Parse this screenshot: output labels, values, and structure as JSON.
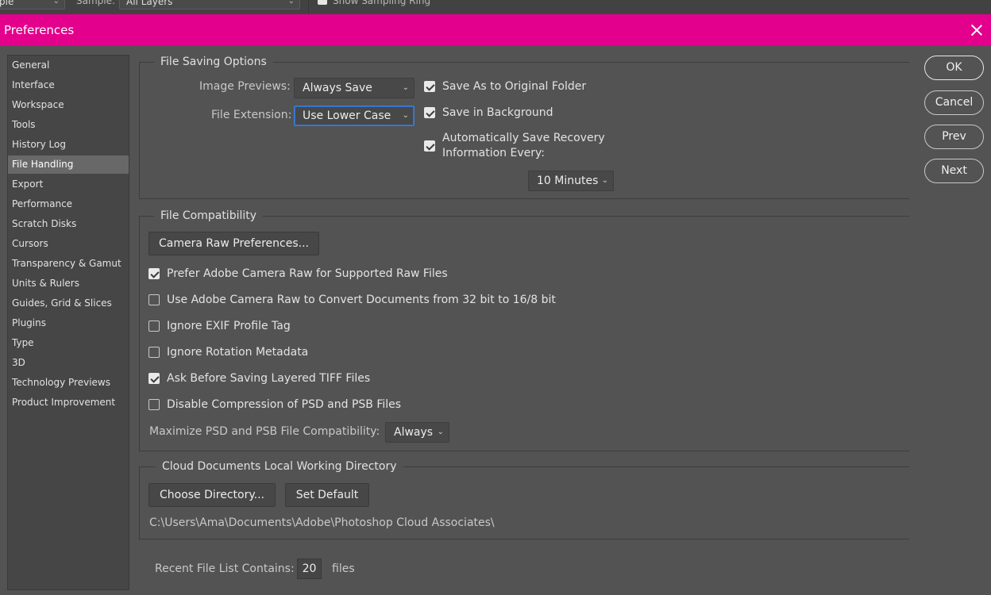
{
  "toolbar": {
    "sample_value": "ple",
    "sampler_label": "Sample:",
    "sampler_value": "All Layers",
    "show_ring_label": "Show Sampling Ring"
  },
  "dialog": {
    "title": "Preferences"
  },
  "nav": {
    "items": [
      {
        "label": "General"
      },
      {
        "label": "Interface"
      },
      {
        "label": "Workspace"
      },
      {
        "label": "Tools"
      },
      {
        "label": "History Log"
      },
      {
        "label": "File Handling",
        "selected": true
      },
      {
        "label": "Export"
      },
      {
        "label": "Performance"
      },
      {
        "label": "Scratch Disks"
      },
      {
        "label": "Cursors"
      },
      {
        "label": "Transparency & Gamut"
      },
      {
        "label": "Units & Rulers"
      },
      {
        "label": "Guides, Grid & Slices"
      },
      {
        "label": "Plugins"
      },
      {
        "label": "Type"
      },
      {
        "label": "3D"
      },
      {
        "label": "Technology Previews"
      },
      {
        "label": "Product Improvement"
      }
    ]
  },
  "file_saving": {
    "title": "File Saving Options",
    "image_previews_label": "Image Previews:",
    "image_previews_value": "Always Save",
    "file_extension_label": "File Extension:",
    "file_extension_value": "Use Lower Case",
    "save_original_folder": {
      "label": "Save As to Original Folder",
      "checked": true
    },
    "save_background": {
      "label": "Save in Background",
      "checked": true
    },
    "auto_save": {
      "label_line1": "Automatically Save Recovery",
      "label_line2": "Information Every:",
      "checked": true
    },
    "auto_save_interval": "10 Minutes"
  },
  "file_compat": {
    "title": "File Compatibility",
    "camera_raw_button": "Camera Raw Preferences...",
    "options": [
      {
        "label": "Prefer Adobe Camera Raw for Supported Raw Files",
        "checked": true
      },
      {
        "label": "Use Adobe Camera Raw to Convert Documents from 32 bit to 16/8 bit",
        "checked": false
      },
      {
        "label": "Ignore EXIF Profile Tag",
        "checked": false
      },
      {
        "label": "Ignore Rotation Metadata",
        "checked": false
      },
      {
        "label": "Ask Before Saving Layered TIFF Files",
        "checked": true
      },
      {
        "label": "Disable Compression of PSD and PSB Files",
        "checked": false
      }
    ],
    "maximize_label": "Maximize PSD and PSB File Compatibility:",
    "maximize_value": "Always"
  },
  "cloud": {
    "title": "Cloud Documents Local Working Directory",
    "choose_button": "Choose Directory...",
    "default_button": "Set Default",
    "path": "C:\\Users\\Ama\\Documents\\Adobe\\Photoshop Cloud Associates\\"
  },
  "recent": {
    "label": "Recent File List Contains:",
    "value": "20",
    "unit": "files"
  },
  "buttons": {
    "ok": "OK",
    "cancel": "Cancel",
    "prev": "Prev",
    "next": "Next"
  },
  "colors": {
    "titlebar": "#e3008c",
    "background": "#535353",
    "focus_border": "#3b7fd8"
  }
}
